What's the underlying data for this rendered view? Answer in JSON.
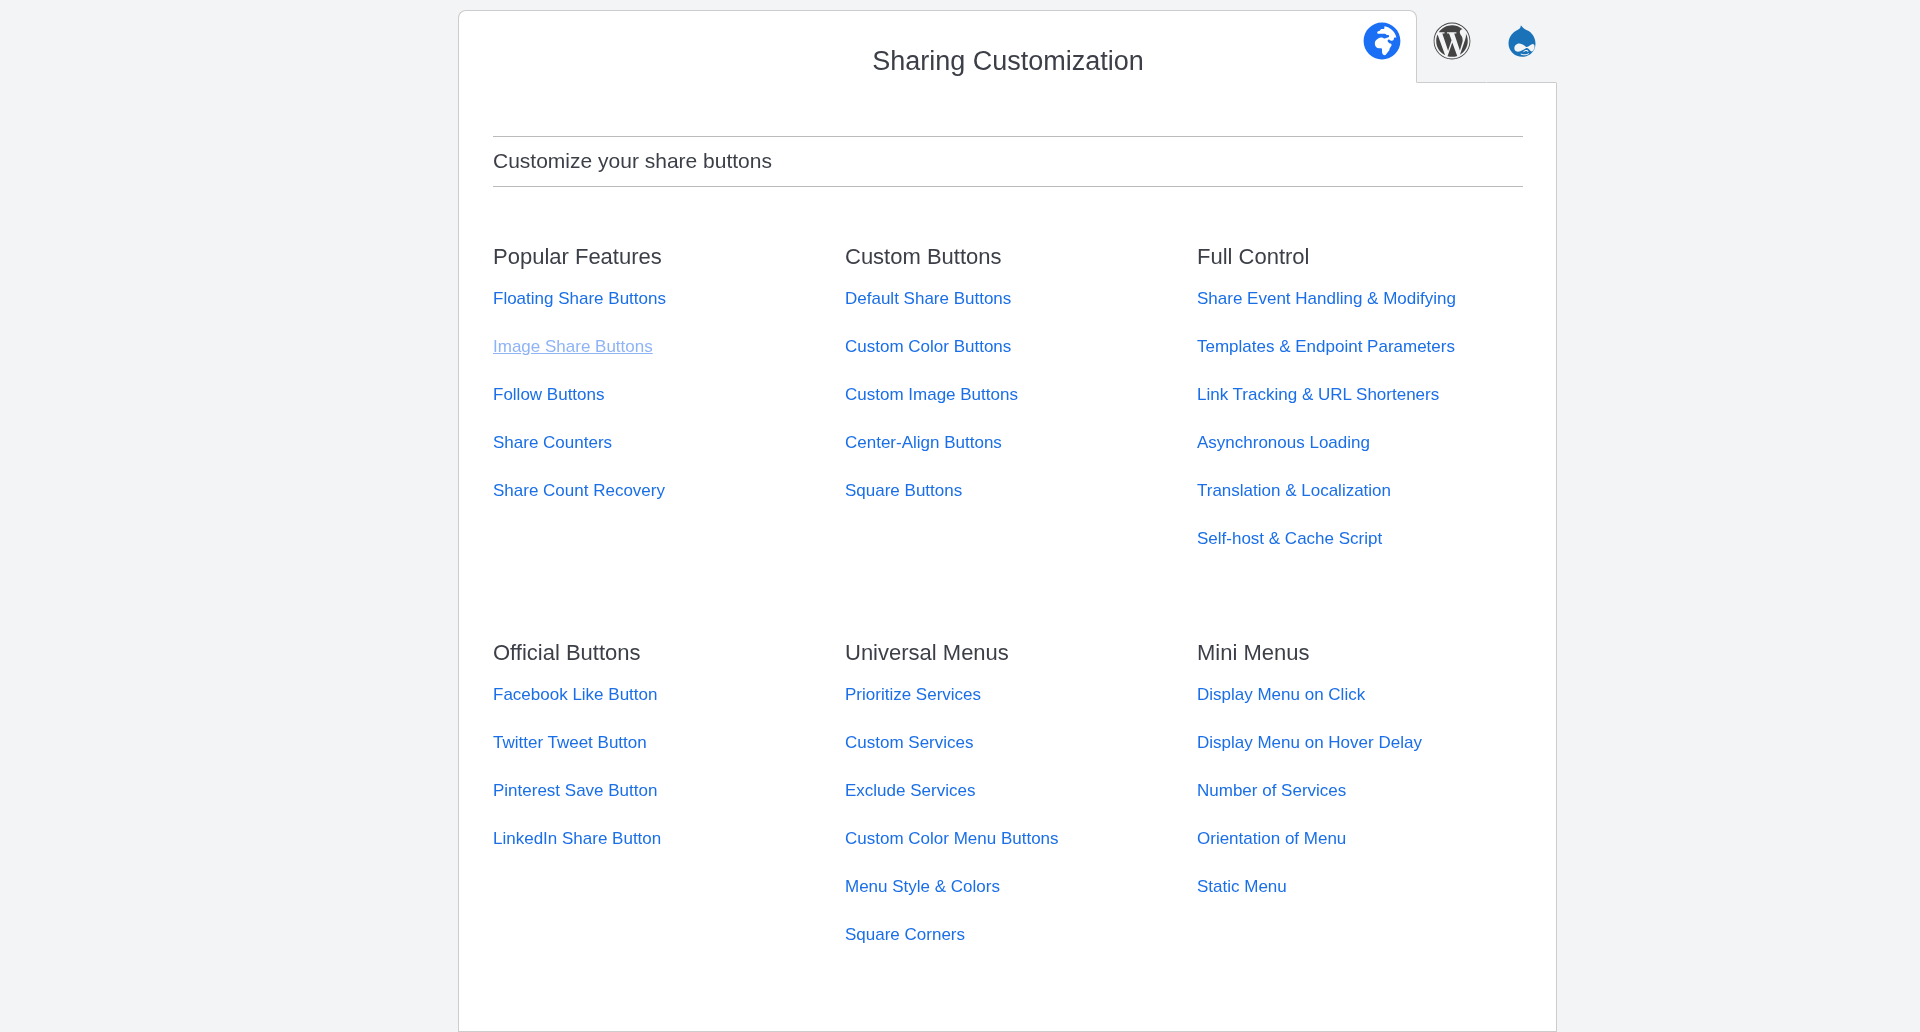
{
  "title": "Sharing Customization",
  "tabs": [
    {
      "kind": "globe",
      "selected": true
    },
    {
      "kind": "wordpress",
      "selected": false
    },
    {
      "kind": "drupal",
      "selected": false
    }
  ],
  "subtitle": "Customize your share buttons",
  "sections": [
    {
      "columns": [
        {
          "heading": "Popular Features",
          "links": [
            {
              "label": "Floating Share Buttons",
              "hovered": false
            },
            {
              "label": "Image Share Buttons",
              "hovered": true
            },
            {
              "label": "Follow Buttons",
              "hovered": false
            },
            {
              "label": "Share Counters",
              "hovered": false
            },
            {
              "label": "Share Count Recovery",
              "hovered": false
            }
          ]
        },
        {
          "heading": "Custom Buttons",
          "links": [
            {
              "label": "Default Share Buttons",
              "hovered": false
            },
            {
              "label": "Custom Color Buttons",
              "hovered": false
            },
            {
              "label": "Custom Image Buttons",
              "hovered": false
            },
            {
              "label": "Center-Align Buttons",
              "hovered": false
            },
            {
              "label": "Square Buttons",
              "hovered": false
            }
          ]
        },
        {
          "heading": "Full Control",
          "links": [
            {
              "label": "Share Event Handling & Modifying",
              "hovered": false
            },
            {
              "label": "Templates & Endpoint Parameters",
              "hovered": false
            },
            {
              "label": "Link Tracking & URL Shorteners",
              "hovered": false
            },
            {
              "label": "Asynchronous Loading",
              "hovered": false
            },
            {
              "label": "Translation & Localization",
              "hovered": false
            },
            {
              "label": "Self-host & Cache Script",
              "hovered": false
            }
          ]
        }
      ]
    },
    {
      "columns": [
        {
          "heading": "Official Buttons",
          "links": [
            {
              "label": "Facebook Like Button",
              "hovered": false
            },
            {
              "label": "Twitter Tweet Button",
              "hovered": false
            },
            {
              "label": "Pinterest Save Button",
              "hovered": false
            },
            {
              "label": "LinkedIn Share Button",
              "hovered": false
            }
          ]
        },
        {
          "heading": "Universal Menus",
          "links": [
            {
              "label": "Prioritize Services",
              "hovered": false
            },
            {
              "label": "Custom Services",
              "hovered": false
            },
            {
              "label": "Exclude Services",
              "hovered": false
            },
            {
              "label": "Custom Color Menu Buttons",
              "hovered": false
            },
            {
              "label": "Menu Style & Colors",
              "hovered": false
            },
            {
              "label": "Square Corners",
              "hovered": false
            }
          ]
        },
        {
          "heading": "Mini Menus",
          "links": [
            {
              "label": "Display Menu on Click",
              "hovered": false
            },
            {
              "label": "Display Menu on Hover Delay",
              "hovered": false
            },
            {
              "label": "Number of Services",
              "hovered": false
            },
            {
              "label": "Orientation of Menu",
              "hovered": false
            },
            {
              "label": "Static Menu",
              "hovered": false
            }
          ]
        }
      ]
    }
  ]
}
